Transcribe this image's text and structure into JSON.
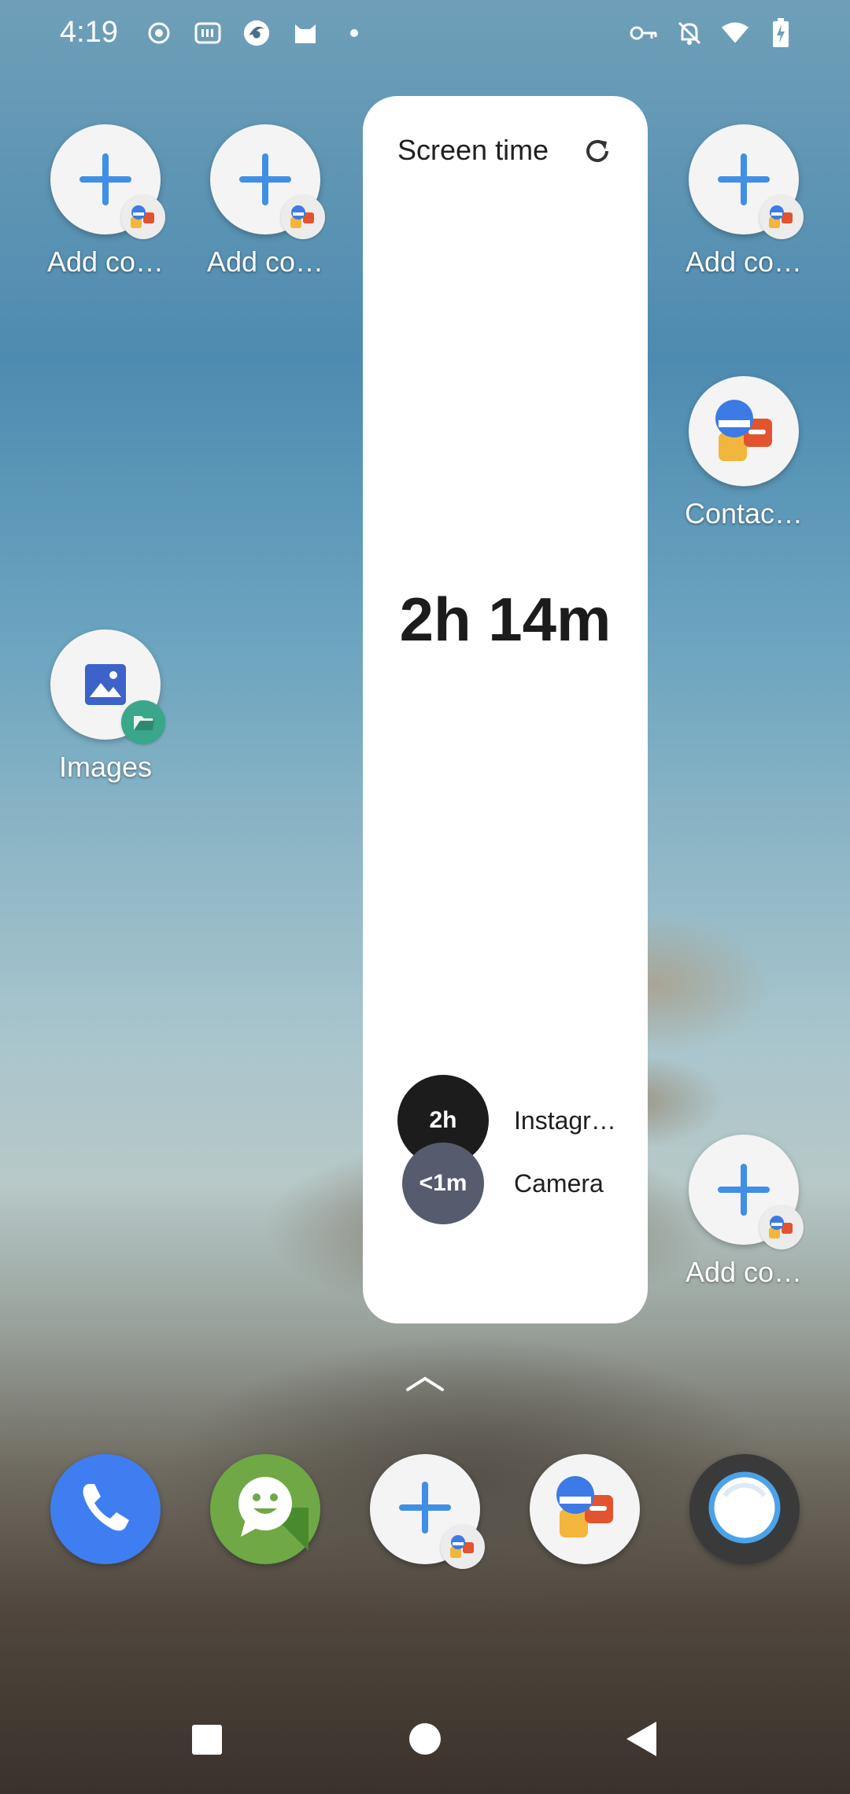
{
  "status_bar": {
    "time": "4:19",
    "left_icons": [
      "record-icon",
      "iqiyi-icon",
      "browser-icon",
      "cat-icon",
      "dot-icon"
    ],
    "right_icons": [
      "vpn-key-icon",
      "mute-icon",
      "wifi-icon",
      "battery-charging-icon"
    ]
  },
  "apps": [
    {
      "label": "Add co…",
      "icon": "add-contact-icon"
    },
    {
      "label": "Add co…",
      "icon": "add-contact-icon"
    },
    {
      "label": "Add co…",
      "icon": "add-contact-icon"
    },
    {
      "label": "Contac…",
      "icon": "contacts-icon"
    },
    {
      "label": "Images",
      "icon": "images-icon"
    },
    {
      "label": "Add co…",
      "icon": "add-contact-icon"
    }
  ],
  "widget": {
    "title": "Screen time",
    "total": "2h 14m",
    "usage": [
      {
        "duration": "2h",
        "app": "Instagr…",
        "color": "#1c1c1c"
      },
      {
        "duration": "<1m",
        "app": "Camera",
        "color": "#565b6e"
      }
    ]
  },
  "dock": [
    {
      "icon": "phone-icon",
      "color": "#3f7ef0"
    },
    {
      "icon": "messaging-icon",
      "color": "#6fa845"
    },
    {
      "icon": "add-contact-icon",
      "color": "#f4f4f4"
    },
    {
      "icon": "contacts-icon",
      "color": "#f4f4f4"
    },
    {
      "icon": "camera-ring-icon",
      "color": "#3a3a3a"
    }
  ],
  "nav": [
    "recents-button",
    "home-button",
    "back-button"
  ]
}
